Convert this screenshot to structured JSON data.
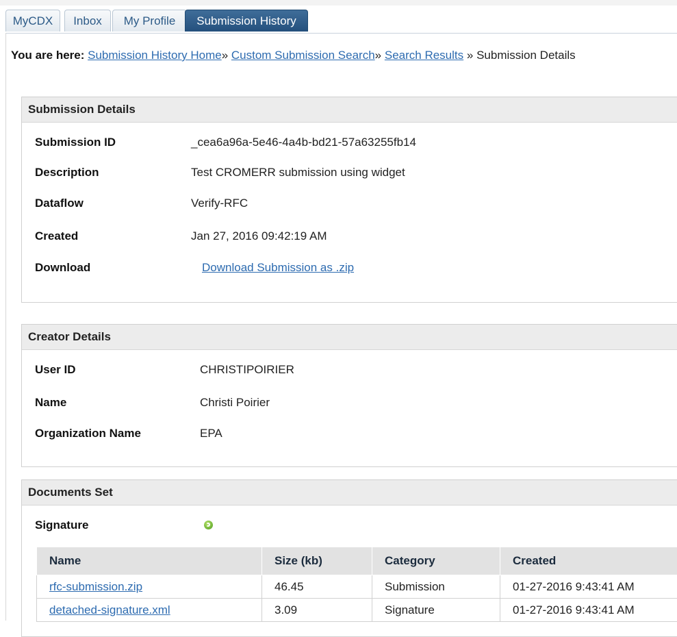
{
  "tabs": [
    {
      "label": "MyCDX"
    },
    {
      "label": "Inbox"
    },
    {
      "label": "My Profile"
    },
    {
      "label": "Submission History",
      "active": true
    }
  ],
  "breadcrumb": {
    "prefix": "You are here:",
    "links": [
      "Submission History Home",
      "Custom Submission Search",
      "Search Results"
    ],
    "separator": "»",
    "current": "Submission Details"
  },
  "submission_details": {
    "title": "Submission Details",
    "rows": [
      {
        "label": "Submission ID",
        "value": "_cea6a96a-5e46-4a4b-bd21-57a63255fb14"
      },
      {
        "label": "Description",
        "value": "Test CROMERR submission using widget"
      },
      {
        "label": "Dataflow",
        "value": "Verify-RFC"
      },
      {
        "label": "Created",
        "value": "Jan 27, 2016 09:42:19 AM"
      },
      {
        "label": "Download",
        "value": "Download Submission as .zip"
      }
    ]
  },
  "creator_details": {
    "title": "Creator Details",
    "rows": [
      {
        "label": "User ID",
        "value": "CHRISTIPOIRIER"
      },
      {
        "label": "Name",
        "value": "Christi Poirier"
      },
      {
        "label": "Organization Name",
        "value": "EPA"
      }
    ]
  },
  "documents_set": {
    "title": "Documents Set",
    "signature_label": "Signature",
    "signature_icon": "green-refresh-icon",
    "columns": [
      "Name",
      "Size (kb)",
      "Category",
      "Created"
    ],
    "rows": [
      [
        "rfc-submission.zip",
        "46.45",
        "Submission",
        "01-27-2016 9:43:41 AM"
      ],
      [
        "detached-signature.xml",
        "3.09",
        "Signature",
        "01-27-2016 9:43:41 AM"
      ]
    ]
  },
  "colors": {
    "link": "#2d6bb0",
    "active_tab": "#2d5b88",
    "panel_header": "#ececec"
  }
}
